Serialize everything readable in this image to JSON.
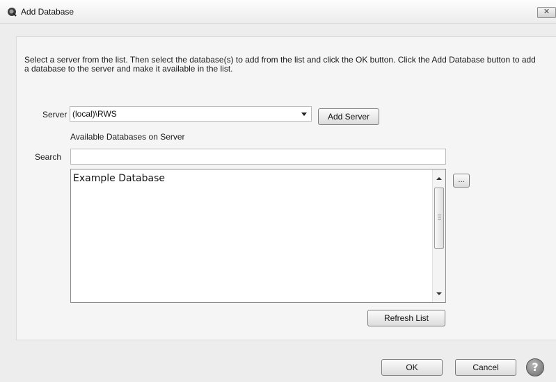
{
  "window": {
    "title": "Add Database",
    "close_glyph": "✕"
  },
  "instructions": "Select a server from the list.  Then select the database(s) to add from the list and click the OK button.  Click the Add Database button to add a database to the server and make it available in the list.",
  "server": {
    "label": "Server",
    "selected": "(local)\\RWS",
    "add_button": "Add Server"
  },
  "available_label": "Available Databases on Server",
  "search": {
    "label": "Search",
    "value": ""
  },
  "databases": [
    "Example Database"
  ],
  "browse_button": "...",
  "refresh_button": "Refresh List",
  "footer": {
    "ok": "OK",
    "cancel": "Cancel",
    "help": "?"
  },
  "icons": {
    "app": "search-circle-icon",
    "help": "help-icon"
  }
}
